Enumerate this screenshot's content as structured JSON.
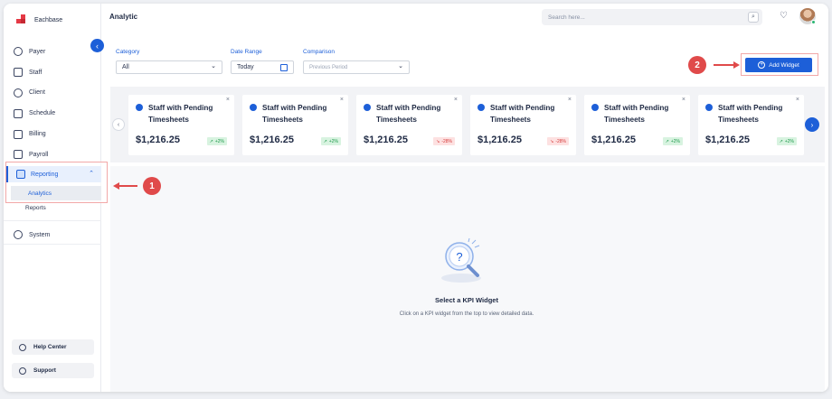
{
  "brand": {
    "name": "Eachbase"
  },
  "header": {
    "title": "Analytic",
    "search_placeholder": "Search here..."
  },
  "sidebar": {
    "items": [
      {
        "label": "Payer",
        "icon": "shield-icon"
      },
      {
        "label": "Staff",
        "icon": "staff-icon"
      },
      {
        "label": "Client",
        "icon": "client-icon"
      },
      {
        "label": "Schedule",
        "icon": "calendar-icon"
      },
      {
        "label": "Billing",
        "icon": "billing-icon"
      },
      {
        "label": "Payroll",
        "icon": "payroll-icon"
      }
    ],
    "reporting": {
      "label": "Reporting",
      "icon": "report-icon",
      "subitems": [
        "Analytics",
        "Reports"
      ]
    },
    "system": {
      "label": "System",
      "icon": "system-icon"
    },
    "help": "Help Center",
    "support": "Support"
  },
  "filters": {
    "category": {
      "label": "Category",
      "value": "All"
    },
    "date_range": {
      "label": "Date Range",
      "value": "Today"
    },
    "comparison": {
      "label": "Comparison",
      "placeholder": "Previous Period"
    }
  },
  "add_widget": {
    "label": "Add Widget"
  },
  "callouts": [
    "1",
    "2"
  ],
  "kpis": [
    {
      "title": "Staff with Pending Timesheets",
      "value": "$1,216.25",
      "change": "+2%",
      "trend": "up"
    },
    {
      "title": "Staff with Pending Timesheets",
      "value": "$1,216.25",
      "change": "+2%",
      "trend": "up"
    },
    {
      "title": "Staff with Pending Timesheets",
      "value": "$1,216.25",
      "change": "-28%",
      "trend": "down"
    },
    {
      "title": "Staff with Pending Timesheets",
      "value": "$1,216.25",
      "change": "-28%",
      "trend": "down"
    },
    {
      "title": "Staff with Pending Timesheets",
      "value": "$1,216.25",
      "change": "+2%",
      "trend": "up"
    },
    {
      "title": "Staff with Pending Timesheets",
      "value": "$1,216.25",
      "change": "+2%",
      "trend": "up"
    }
  ],
  "empty_state": {
    "title": "Select a KPI Widget",
    "description": "Click on a KPI widget from the top to view detailed data."
  },
  "colors": {
    "accent": "#1d5fd8",
    "callout": "#e04a4a",
    "up": "#1e9a4b",
    "down": "#d63b3b"
  }
}
